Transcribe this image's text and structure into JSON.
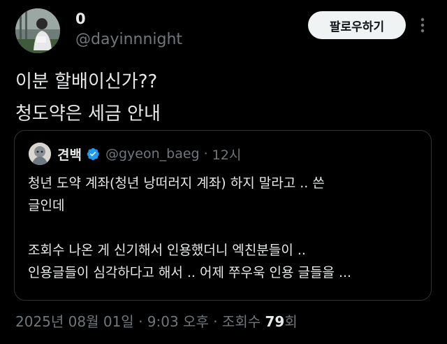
{
  "author": {
    "display_name": "0",
    "handle": "@dayinnnight",
    "avatar_icon": "profile-photo-person-reading"
  },
  "follow_button": {
    "label": "팔로우하기"
  },
  "more_icon": "three-dots-vertical-icon",
  "tweet": {
    "text": "이분 할배이신가??\n청도약은 세금 안내"
  },
  "quoted": {
    "name": "견백",
    "verified": true,
    "handle": "@gyeon_baeg",
    "separator": "·",
    "time": "12시",
    "text": "청년 도약 계좌(청년 낭떠러지 계좌) 하지 말라고 .. 쓴\n글인데\n\n조회수 나온 게 신기해서 인용했더니 엑친분들이 ..\n인용글들이 심각하다고 해서 .. 어제 쭈우욱 인용 글들을 ..."
  },
  "meta": {
    "datetime": "2025년 08월 01일 · 9:03 오후 · 조회수 ",
    "views": "79",
    "views_suffix": "회"
  },
  "colors": {
    "background": "#000000",
    "text": "#e7e9ea",
    "secondary": "#71767b",
    "border": "#2f3336",
    "verified": "#1d9bf0",
    "button_bg": "#eff3f4"
  }
}
